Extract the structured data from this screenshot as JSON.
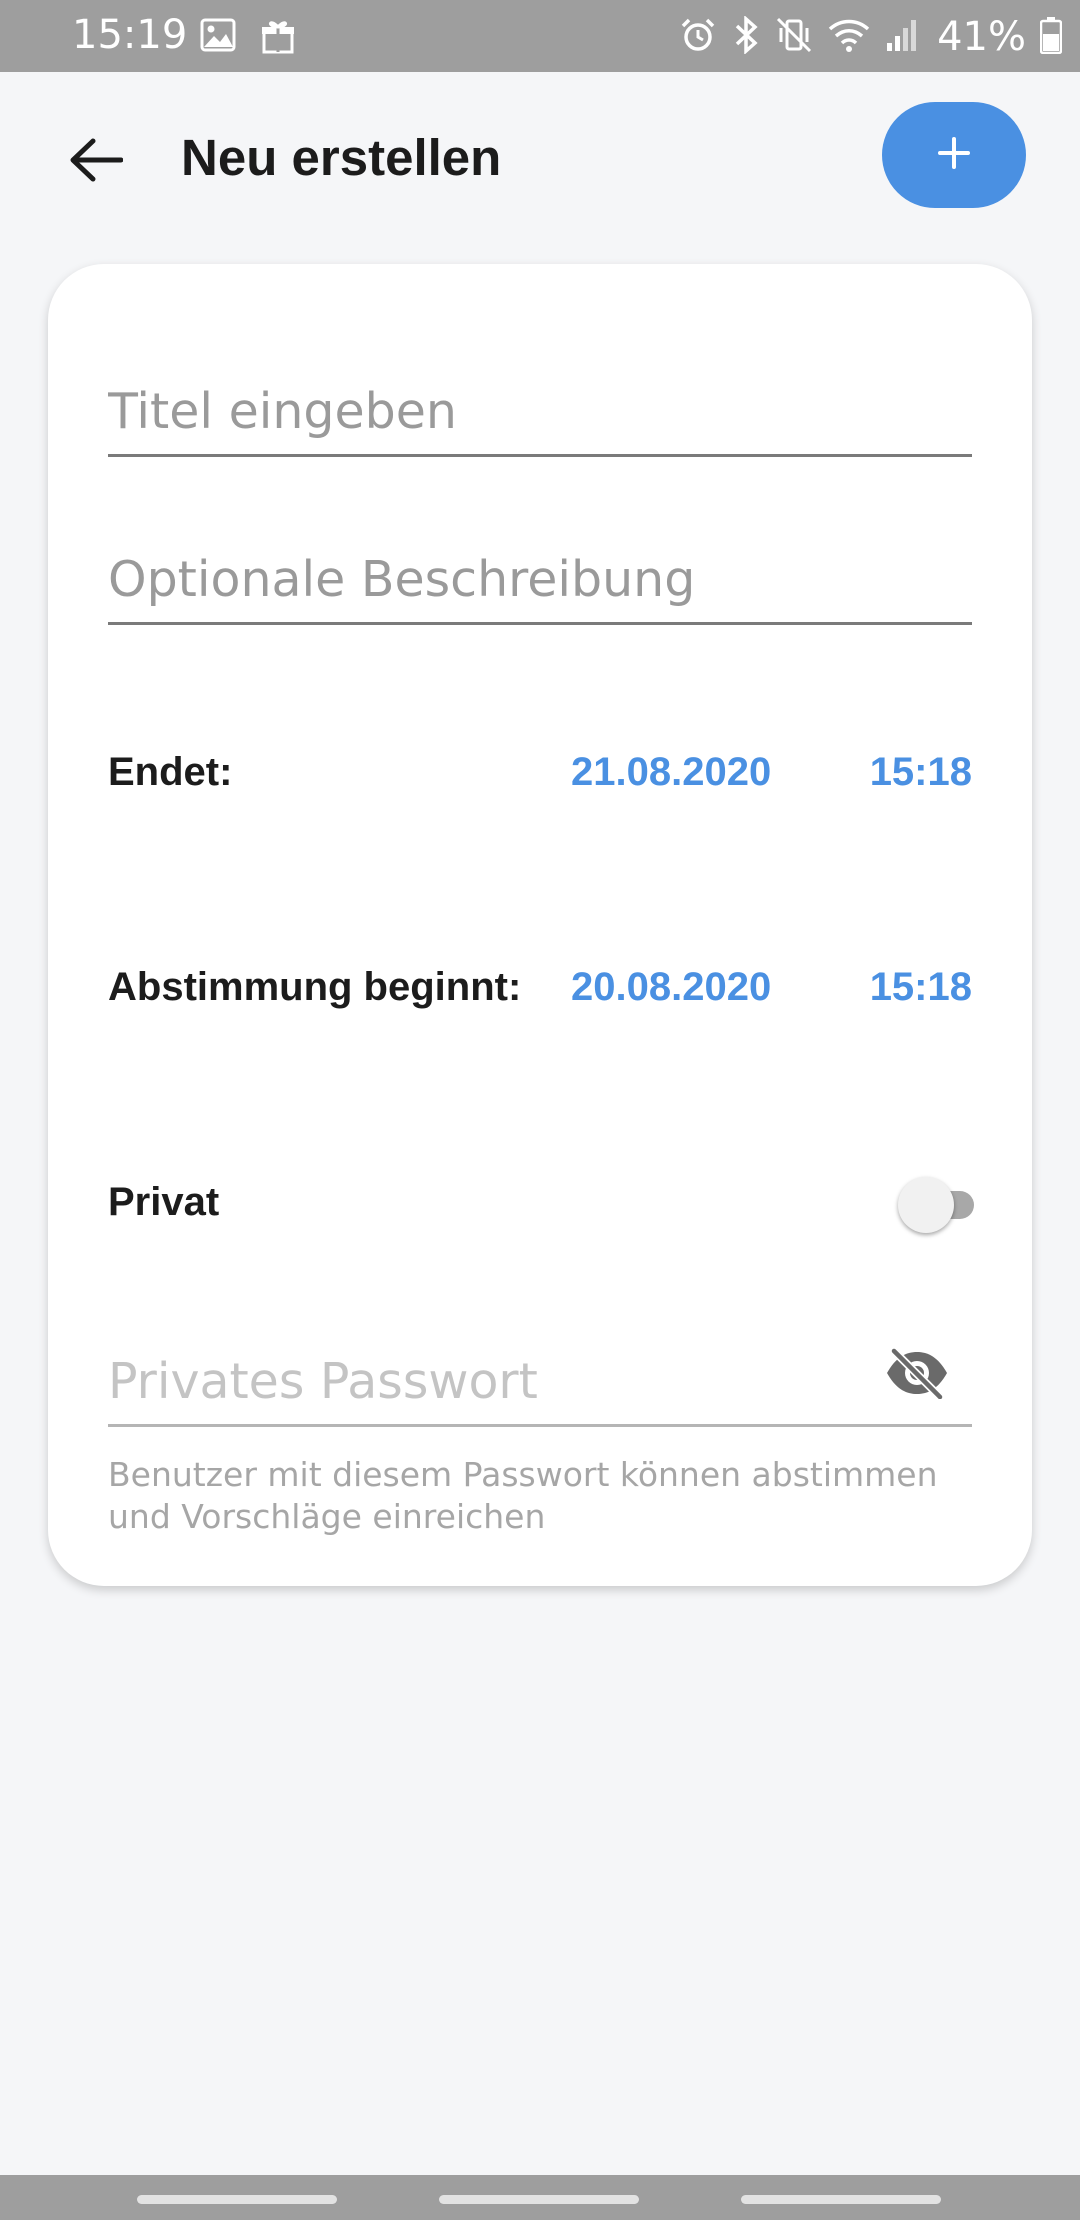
{
  "status_bar": {
    "time": "15:19",
    "battery": "41%",
    "left_icons": [
      "image-icon",
      "gift-icon"
    ],
    "right_icons": [
      "alarm-icon",
      "bluetooth-icon",
      "vibrate-icon",
      "wifi-icon",
      "signal-icon",
      "battery-icon"
    ]
  },
  "app_bar": {
    "title": "Neu erstellen",
    "back_icon": "arrow-left-icon",
    "add_icon": "plus-icon"
  },
  "form": {
    "title_placeholder": "Titel eingeben",
    "title_value": "",
    "description_placeholder": "Optionale Beschreibung",
    "description_value": "",
    "ends_label": "Endet:",
    "ends_date": "21.08.2020",
    "ends_time": "15:18",
    "starts_label": "Abstimmung beginnt:",
    "starts_date": "20.08.2020",
    "starts_time": "15:18",
    "private_label": "Privat",
    "private_enabled": false,
    "password_placeholder": "Privates Passwort",
    "password_value": "",
    "password_helper": "Benutzer mit diesem Passwort können abstimmen und Vorschläge einreichen"
  },
  "colors": {
    "accent": "#4a90e2",
    "background": "#f5f6f8",
    "card": "#ffffff",
    "status_bar": "#9e9e9e"
  }
}
